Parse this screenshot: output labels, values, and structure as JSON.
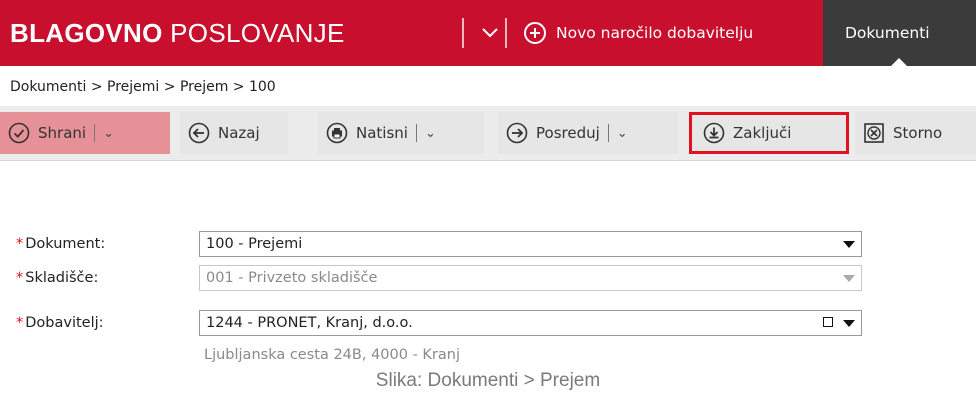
{
  "header": {
    "title_bold": "BLAGOVNO",
    "title_rest": "POSLOVANJE",
    "new_order_label": "Novo naročilo dobavitelju",
    "active_tab": "Dokumenti"
  },
  "breadcrumb": "Dokumenti > Prejemi > Prejem > 100",
  "toolbar": {
    "save": "Shrani",
    "back": "Nazaj",
    "print": "Natisni",
    "forward": "Posreduj",
    "close": "Zaključi",
    "storno": "Storno"
  },
  "form": {
    "document_label": "Dokument:",
    "document_value": "100 - Prejemi",
    "warehouse_label": "Skladišče:",
    "warehouse_value": "001 - Privzeto skladišče",
    "supplier_label": "Dobavitelj:",
    "supplier_value": "1244 - PRONET, Kranj, d.o.o.",
    "supplier_address": "Ljubljanska cesta 24B, 4000 - Kranj",
    "required_mark": "*"
  },
  "caption": "Slika: Dokumenti > Prejem",
  "colors": {
    "brand_red": "#c8102e",
    "dark_tab": "#3b3b3b",
    "save_button": "#e69198",
    "highlight_outline": "#e0121f"
  },
  "icons": [
    "chevron-down-icon",
    "plus-circle-icon",
    "check-circle-icon",
    "arrow-left-circle-icon",
    "printer-circle-icon",
    "arrow-right-circle-icon",
    "download-circle-icon",
    "storno-box-icon"
  ]
}
